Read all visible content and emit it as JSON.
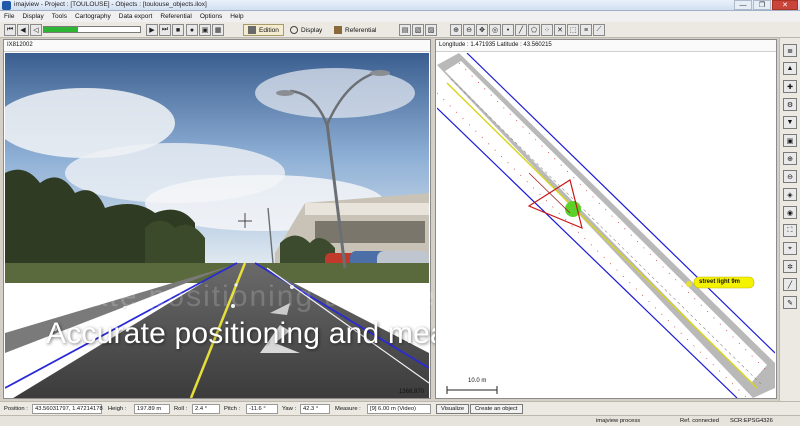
{
  "window": {
    "title": "imajview - Project : [TOULOUSE] - Objects : [toulouse_objects.ilox]",
    "buttons": [
      "—",
      "❐",
      "✕"
    ]
  },
  "menu": [
    "File",
    "Display",
    "Tools",
    "Cartography",
    "Data export",
    "Referential",
    "Options",
    "Help"
  ],
  "toolbar": {
    "progress": 0.35,
    "modes": {
      "edition": "Edition",
      "display": "Display",
      "referential": "Referential"
    }
  },
  "left_view": {
    "header": "IX812002",
    "frame_number": "1368,970"
  },
  "right_view": {
    "header": "Longitude : 1.471935 Latitude : 43.560215",
    "scale_label": "10.0 m",
    "callout": "street light 9m"
  },
  "overlay_text": "Accurate positioning and measurement",
  "statusbar": {
    "position_label": "Position :",
    "position_value": "43.56031797, 1.47214178",
    "height_label": "Heigh :",
    "height_value": "197.89 m",
    "roll_label": "Roll :",
    "roll_value": "2.4 °",
    "pitch_label": "Pitch :",
    "pitch_value": "-11.6 °",
    "yaw_label": "Yaw :",
    "yaw_value": "42.3 °",
    "measure_label": "Measure :",
    "measure_value": "[9] 6.00 m (Video)",
    "visualize_button": "Visualize",
    "create_button": "Create an object"
  },
  "footer": {
    "process": "imajview process",
    "connection": "Ref. connected",
    "srs": "SCR:EPSG4326"
  },
  "colors": {
    "progress_fill": "#2fb534",
    "road_line": "#1b1bd6",
    "road_center": "#d8d41b",
    "callout_bg": "#f5f200",
    "highlight": "#5bd12a",
    "marker": "#c81a1a"
  }
}
